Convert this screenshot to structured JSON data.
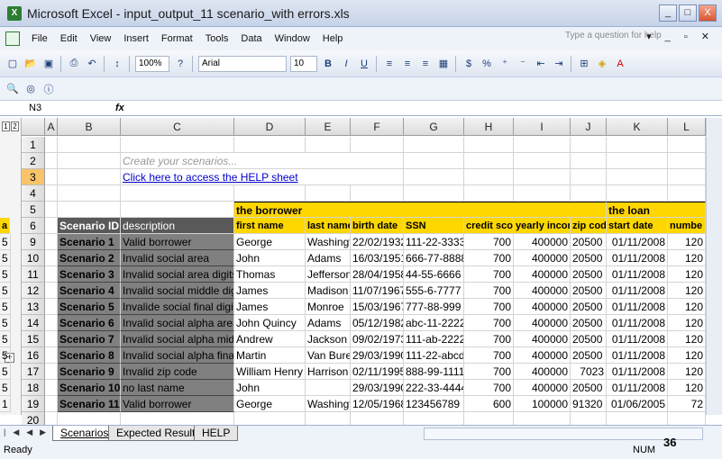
{
  "window": {
    "title": "Microsoft Excel - input_output_11 scenario_with errors.xls",
    "buttons": [
      "_",
      "□",
      "X"
    ]
  },
  "menu": {
    "items": [
      "File",
      "Edit",
      "View",
      "Insert",
      "Format",
      "Tools",
      "Data",
      "Window",
      "Help"
    ],
    "ask_placeholder": "Type a question for help"
  },
  "toolbar": {
    "zoom": "100%",
    "font": "Arial",
    "font_size": "10",
    "bold": "B",
    "italic": "I",
    "underline": "U",
    "percent": "%"
  },
  "formula": {
    "name_box": "N3",
    "fx": "fx",
    "content": ""
  },
  "outline": {
    "levels": [
      "1",
      "2"
    ],
    "expand": "+"
  },
  "columns": [
    "A",
    "B",
    "C",
    "D",
    "E",
    "F",
    "G",
    "H",
    "I",
    "J",
    "K",
    "L"
  ],
  "rows": [
    "1",
    "2",
    "3",
    "4",
    "5",
    "6",
    "9",
    "10",
    "11",
    "12",
    "13",
    "14",
    "15",
    "16",
    "17",
    "18",
    "19",
    "20"
  ],
  "sheet": {
    "r2_text": "Create your scenarios...",
    "r3_link": "Click here to access the HELP sheet",
    "r5_borrower": "the borrower",
    "r5_loan": "the loan",
    "headers": [
      "Scenario ID",
      "description",
      "first name",
      "last name",
      "birth date",
      "SSN",
      "credit score",
      "yearly income",
      "zip code",
      "start date",
      "numbe",
      "a"
    ],
    "data": [
      [
        "Scenario 1",
        "Valid borrower",
        "George",
        "Washingt",
        "22/02/1932",
        "111-22-3333",
        "700",
        "400000",
        "20500",
        "01/11/2008",
        "120",
        "5"
      ],
      [
        "Scenario 2",
        "Invalid social area",
        "John",
        "Adams",
        "16/03/1951",
        "666-77-8888",
        "700",
        "400000",
        "20500",
        "01/11/2008",
        "120",
        "5"
      ],
      [
        "Scenario 3",
        "Invalid social area digits",
        "Thomas",
        "Jefferson",
        "28/04/1958",
        "44-55-6666",
        "700",
        "400000",
        "20500",
        "01/11/2008",
        "120",
        "5"
      ],
      [
        "Scenario 4",
        "Invalid social middle digits",
        "James",
        "Madison",
        "11/07/1967",
        "555-6-7777",
        "700",
        "400000",
        "20500",
        "01/11/2008",
        "120",
        "5"
      ],
      [
        "Scenario 5",
        "Invalide social final digits",
        "James",
        "Monroe",
        "15/03/1967",
        "777-88-999",
        "700",
        "400000",
        "20500",
        "01/11/2008",
        "120",
        "5"
      ],
      [
        "Scenario 6",
        "Invalid social alpha area",
        "John Quincy",
        "Adams",
        "05/12/1982",
        "abc-11-2222",
        "700",
        "400000",
        "20500",
        "01/11/2008",
        "120",
        "5"
      ],
      [
        "Scenario 7",
        "Invalid social alpha middle",
        "Andrew",
        "Jackson",
        "09/02/1973",
        "111-ab-2222",
        "700",
        "400000",
        "20500",
        "01/11/2008",
        "120",
        "5"
      ],
      [
        "Scenario 8",
        "Invalid social alpha final",
        "Martin",
        "Van Bure",
        "29/03/1990",
        "111-22-abcd",
        "700",
        "400000",
        "20500",
        "01/11/2008",
        "120",
        "5"
      ],
      [
        "Scenario 9",
        "Invalid zip code",
        "William Henry",
        "Harrison",
        "02/11/1995",
        "888-99-1111",
        "700",
        "400000",
        "7023",
        "01/11/2008",
        "120",
        "5"
      ],
      [
        "Scenario 10",
        "no last name",
        "John",
        "",
        "29/03/1990",
        "222-33-4444",
        "700",
        "400000",
        "20500",
        "01/11/2008",
        "120",
        "5"
      ],
      [
        "Scenario 11",
        "Valid borrower",
        "George",
        "Washingt",
        "12/05/1968",
        "123456789",
        "600",
        "100000",
        "91320",
        "01/06/2005",
        "72",
        "1"
      ]
    ]
  },
  "tabs": [
    "Scenarios",
    "Expected Results",
    "HELP"
  ],
  "status": {
    "left": "Ready",
    "right": "NUM"
  },
  "page_number": "36",
  "colors": {
    "yellow": "#ffd700",
    "gray": "#808080",
    "dark_gray": "#595959",
    "select": "#f7c46a",
    "link": "#0000cc"
  }
}
